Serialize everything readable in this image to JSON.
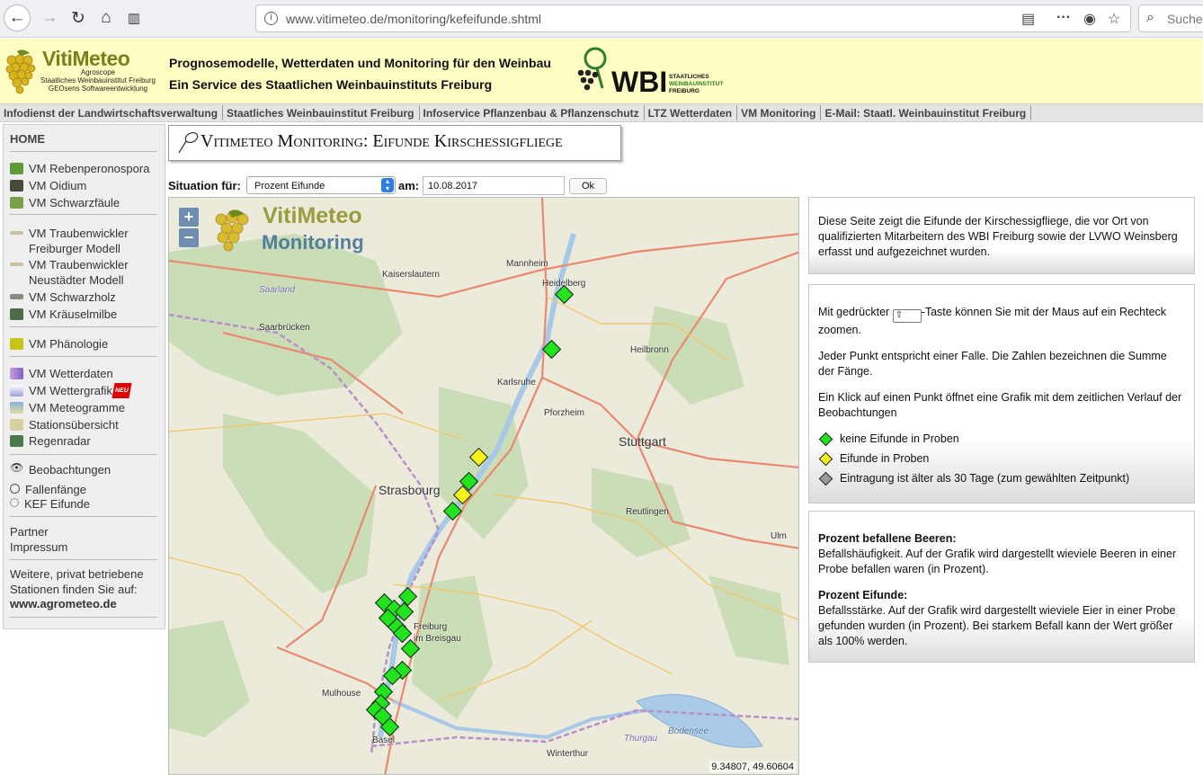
{
  "browser": {
    "url": "www.vitimeteo.de/monitoring/kefeifunde.shtml",
    "search_placeholder": "Suche"
  },
  "header": {
    "logo_title": "VitiMeteo",
    "logo_sub_1": "Agroscope",
    "logo_sub_2": "Staatliches Weinbauinstitut Freiburg",
    "logo_sub_3": "GEOsens Softwareentwicklung",
    "line1": "Prognosemodelle, Wetterdaten und Monitoring für den Weinbau",
    "line2": "Ein Service des Staatlichen Weinbauinstituts Freiburg",
    "wbi_text": "WBI",
    "wbi_sub_1": "STAATLICHES",
    "wbi_sub_2": "WEINBAUINSTITUT",
    "wbi_sub_3": "FREIBURG"
  },
  "top_links": [
    "Infodienst der Landwirtschaftsverwaltung",
    "Staatliches Weinbauinstitut Freiburg",
    "Infoservice Pflanzenbau & Pflanzenschutz",
    "LTZ Wetterdaten",
    "VM Monitoring",
    "E-Mail: Staatl. Weinbauinstitut Freiburg"
  ],
  "sidebar": {
    "home": "HOME",
    "items": [
      "VM Rebenperonospora",
      "VM Oidium",
      "VM Schwarzfäule",
      "VM Traubenwickler",
      "Freiburger Modell",
      "VM Traubenwickler",
      "Neustädter Modell",
      "VM Schwarzholz",
      "VM Kräuselmilbe",
      "VM Phänologie",
      "VM Wetterdaten",
      "VM Wettergrafik",
      "VM Meteogramme",
      "Stationsübersicht",
      "Regenradar",
      "Beobachtungen",
      "Fallenfänge",
      "KEF Eifunde",
      "Partner",
      "Impressum",
      "Weitere, privat betriebene",
      "Stationen finden Sie auf:",
      "www.agrometeo.de"
    ],
    "neu_badge": "NEU"
  },
  "page_title": "Vitimeteo Monitoring: Eifunde Kirschessigfliege",
  "controls": {
    "situation_label": "Situation für:",
    "situation_value": "Prozent Eifunde",
    "am_label": "am:",
    "date_value": "10.08.2017",
    "ok_label": "Ok"
  },
  "map": {
    "logo_t1": "VitiMeteo",
    "logo_t2": "Monitoring",
    "zoom_in": "+",
    "zoom_out": "−",
    "coords": "9.34807, 49.60604",
    "cities": [
      "Kaiserslautern",
      "Mannheim",
      "Heidelberg",
      "Saarland",
      "Saarbrücken",
      "Heilbronn",
      "Karlsruhe",
      "Pforzheim",
      "Stuttgart",
      "Strasbourg",
      "Reutlingen",
      "Ulm",
      "Freiburg",
      "im Breisgau",
      "Mulhouse",
      "Basel",
      "Winterthur",
      "Bodensee",
      "Thurgau"
    ],
    "markers": [
      {
        "status": "green"
      },
      {
        "status": "green"
      },
      {
        "status": "yellow"
      },
      {
        "status": "green"
      },
      {
        "status": "yellow"
      },
      {
        "status": "green"
      },
      {
        "status": "green"
      },
      {
        "status": "green"
      },
      {
        "status": "green"
      },
      {
        "status": "green"
      },
      {
        "status": "green"
      },
      {
        "status": "green"
      },
      {
        "status": "green"
      },
      {
        "status": "green"
      },
      {
        "status": "green"
      },
      {
        "status": "green"
      },
      {
        "status": "green"
      },
      {
        "status": "green"
      },
      {
        "status": "green"
      },
      {
        "status": "green"
      },
      {
        "status": "green"
      }
    ]
  },
  "info": {
    "box1": "Diese Seite zeigt die Eifunde der Kirschessigfliege, die vor Ort von qualifizierten Mitarbeitern des WBI Freiburg sowie der LVWO Weinsberg erfasst und aufgezeichnet wurden.",
    "box2_p1_a": "Mit gedrückter",
    "box2_p1_b": "-Taste können Sie mit der Maus auf ein Rechteck zoomen.",
    "box2_p2": "Jeder Punkt entspricht einer Falle. Die Zahlen bezeichnen die Summe der Fänge.",
    "box2_p3": "Ein Klick auf einen Punkt öffnet eine Grafik mit dem zeitlichen Verlauf der Beobachtungen",
    "legend": [
      {
        "label": "keine Eifunde in Proben",
        "color": "#22e41c"
      },
      {
        "label": "Eifunde in Proben",
        "color": "#f6f41a"
      },
      {
        "label": "Eintragung ist älter als 30 Tage (zum gewählten Zeitpunkt)",
        "color": "#9a9a9a"
      }
    ],
    "box3_h1": "Prozent befallene Beeren:",
    "box3_p1": "Befallshäufigkeit. Auf der Grafik wird dargestellt wieviele Beeren in einer Probe befallen waren (in Prozent).",
    "box3_h2": "Prozent Eifunde:",
    "box3_p2": "Befallsstärke. Auf der Grafik wird dargestellt wieviele Eier in einer Probe gefunden wurden (in Prozent). Bei starkem Befall kann der Wert größer als 100% werden."
  }
}
